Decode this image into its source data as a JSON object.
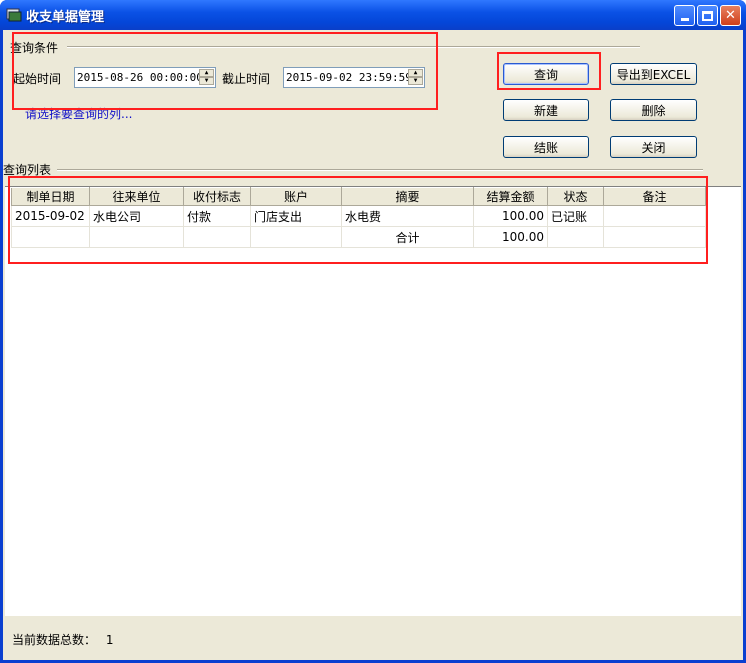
{
  "window": {
    "title": "收支单据管理"
  },
  "query": {
    "group_label": "查询条件",
    "start_label": "起始时间",
    "start_value": "2015-08-26 00:00:00",
    "end_label": "截止时间",
    "end_value": "2015-09-02 23:59:59",
    "choose_columns": "请选择要查询的列..."
  },
  "buttons": {
    "query": "查询",
    "export": "导出到EXCEL",
    "new": "新建",
    "delete": "删除",
    "settle": "结账",
    "close": "关闭"
  },
  "list": {
    "group_label": "查询列表",
    "columns": [
      "制单日期",
      "往来单位",
      "收付标志",
      "账户",
      "摘要",
      "结算金额",
      "状态",
      "备注"
    ],
    "rows": [
      [
        "2015-09-02",
        "水电公司",
        "付款",
        "门店支出",
        "水电费",
        "100.00",
        "已记账",
        ""
      ],
      [
        "",
        "",
        "",
        "",
        "合计",
        "100.00",
        "",
        ""
      ]
    ]
  },
  "status": {
    "label": "当前数据总数：",
    "count": "1"
  },
  "colors": {
    "titlebar": "#0b52e6",
    "highlight": "#ff1f1f",
    "link": "#1010c8"
  }
}
